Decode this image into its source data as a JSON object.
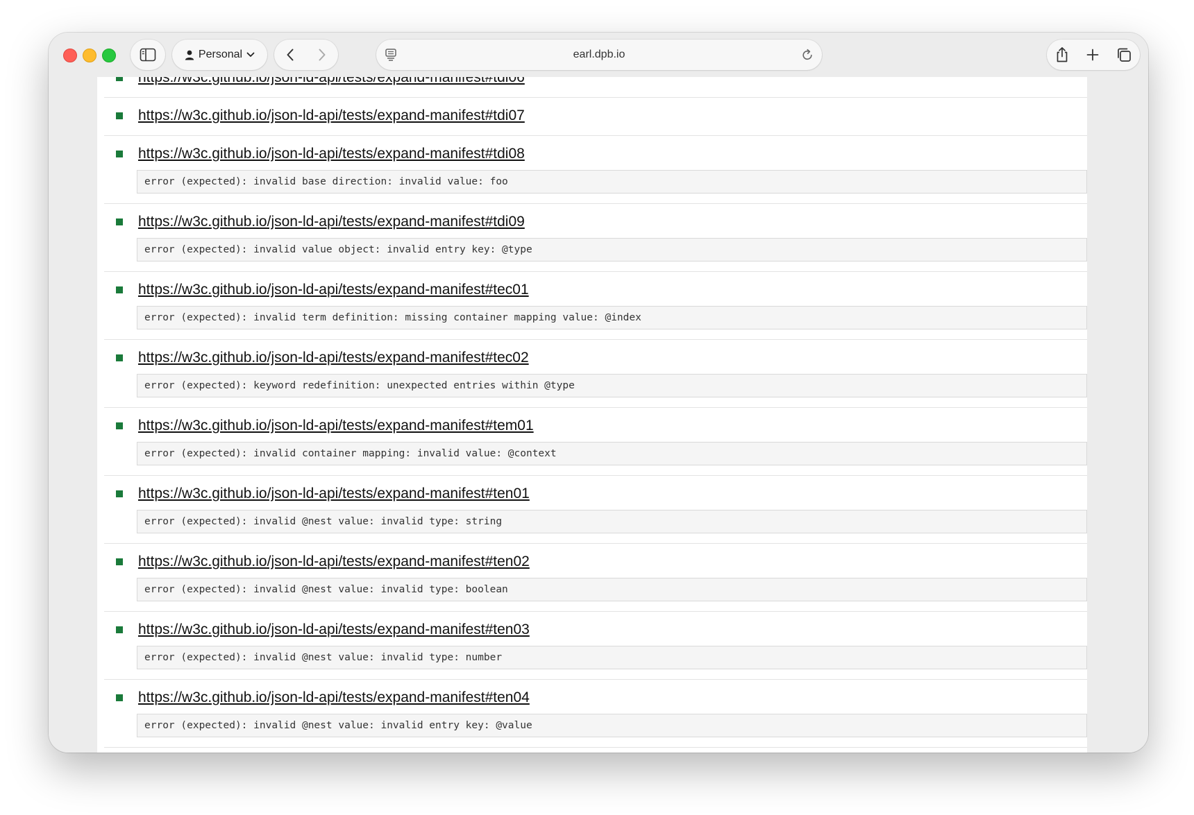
{
  "browser": {
    "profile_label": "Personal",
    "address": "earl.dpb.io",
    "icons": {
      "sidebar": "sidebar-icon",
      "profile": "person-icon",
      "back": "chevron-left-icon",
      "forward": "chevron-right-icon",
      "page": "page-menu-icon",
      "reload": "reload-icon",
      "share": "share-icon",
      "new_tab": "plus-icon",
      "tabs": "tabs-overview-icon"
    }
  },
  "colors": {
    "bullet": "#1a7a3a",
    "error_bg": "#f5f5f5",
    "close": "#ff5f57",
    "minimize": "#febc2e",
    "zoom": "#28c840"
  },
  "tests": [
    {
      "url": "https://w3c.github.io/json-ld-api/tests/expand-manifest#tdi06",
      "error": ""
    },
    {
      "url": "https://w3c.github.io/json-ld-api/tests/expand-manifest#tdi07",
      "error": ""
    },
    {
      "url": "https://w3c.github.io/json-ld-api/tests/expand-manifest#tdi08",
      "error": "error (expected): invalid base direction: invalid value: foo"
    },
    {
      "url": "https://w3c.github.io/json-ld-api/tests/expand-manifest#tdi09",
      "error": "error (expected): invalid value object: invalid entry key: @type"
    },
    {
      "url": "https://w3c.github.io/json-ld-api/tests/expand-manifest#tec01",
      "error": "error (expected): invalid term definition: missing container mapping value: @index"
    },
    {
      "url": "https://w3c.github.io/json-ld-api/tests/expand-manifest#tec02",
      "error": "error (expected): keyword redefinition: unexpected entries within @type"
    },
    {
      "url": "https://w3c.github.io/json-ld-api/tests/expand-manifest#tem01",
      "error": "error (expected): invalid container mapping: invalid value: @context"
    },
    {
      "url": "https://w3c.github.io/json-ld-api/tests/expand-manifest#ten01",
      "error": "error (expected): invalid @nest value: invalid type: string"
    },
    {
      "url": "https://w3c.github.io/json-ld-api/tests/expand-manifest#ten02",
      "error": "error (expected): invalid @nest value: invalid type: boolean"
    },
    {
      "url": "https://w3c.github.io/json-ld-api/tests/expand-manifest#ten03",
      "error": "error (expected): invalid @nest value: invalid type: number"
    },
    {
      "url": "https://w3c.github.io/json-ld-api/tests/expand-manifest#ten04",
      "error": "error (expected): invalid @nest value: invalid entry key: @value"
    }
  ]
}
